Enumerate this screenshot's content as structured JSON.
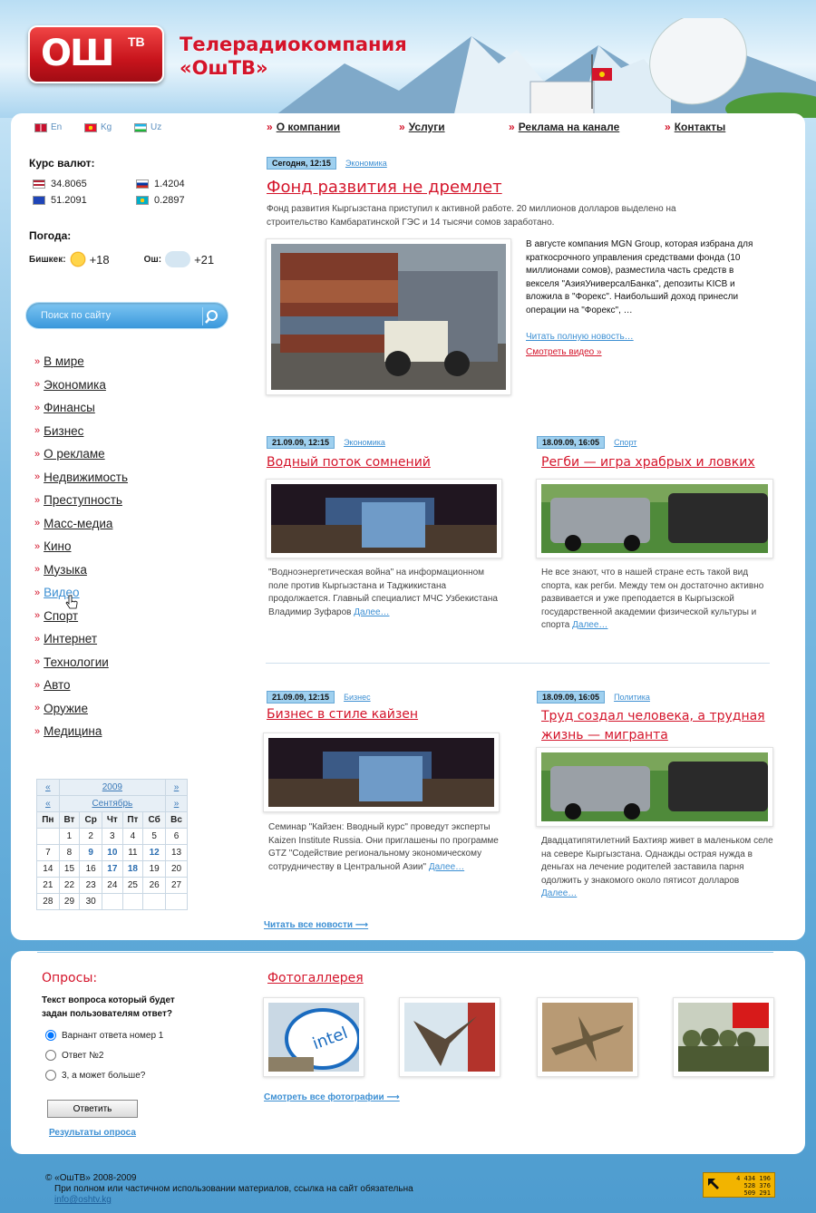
{
  "brand": {
    "logo": "ОШ",
    "logo_sup": "ТВ",
    "name_line1": "Телерадиокомпания",
    "name_line2": "«ОшТВ»"
  },
  "languages": [
    {
      "code": "En",
      "flag": "uk"
    },
    {
      "code": "Kg",
      "flag": "kg"
    },
    {
      "code": "Uz",
      "flag": "uz"
    }
  ],
  "nav": [
    "О компании",
    "Услуги",
    "Реклама на канале",
    "Контакты"
  ],
  "currency": {
    "title": "Курс валют:",
    "rates": [
      {
        "flag": "us",
        "value": "34.8065"
      },
      {
        "flag": "ru",
        "value": "1.4204"
      },
      {
        "flag": "eu",
        "value": "51.2091"
      },
      {
        "flag": "kz",
        "value": "0.2897"
      }
    ]
  },
  "weather": {
    "title": "Погода:",
    "city1": "Бишкек:",
    "temp1": "+18",
    "city2": "Ош:",
    "temp2": "+21"
  },
  "search": {
    "placeholder": "Поиск по сайту"
  },
  "categories": [
    "В мире",
    "Экономика",
    "Финансы",
    "Бизнес",
    "О рекламе",
    "Недвижимость",
    "Преступность",
    "Масс-медиа",
    "Кино",
    "Музыка",
    "Видео",
    "Спорт",
    "Интернет",
    "Технологии",
    "Авто",
    "Оружие",
    "Медицина"
  ],
  "active_category": "Видео",
  "calendar": {
    "year": "2009",
    "month": "Сентябрь",
    "prev": "«",
    "next": "»",
    "weekdays": [
      "Пн",
      "Вт",
      "Ср",
      "Чт",
      "Пт",
      "Сб",
      "Вс"
    ],
    "weeks": [
      [
        "",
        "1",
        "2",
        "3",
        "4",
        "5",
        "6"
      ],
      [
        "7",
        "8",
        "9",
        "10",
        "11",
        "12",
        "13"
      ],
      [
        "14",
        "15",
        "16",
        "17",
        "18",
        "19",
        "20"
      ],
      [
        "21",
        "22",
        "23",
        "24",
        "25",
        "26",
        "27"
      ],
      [
        "28",
        "29",
        "30",
        "",
        "",
        "",
        ""
      ]
    ],
    "linked": [
      "9",
      "10",
      "12",
      "17",
      "18"
    ]
  },
  "main": {
    "date": "Сегодня, 12:15",
    "category": "Экономика",
    "title": "Фонд развития не дремлет",
    "lead": "Фонд развития Кыргызстана приступил к активной работе. 20 миллионов долларов выделено на строительство Камбаратинской ГЭС и 14 тысячи сомов заработано.",
    "body": "В августе компания MGN Group, которая избрана для краткосрочного управления средствами фонда (10 миллионами сомов), разместила часть средств в векселя \"АзияУниверсалБанка\", депозиты KICB и вложила в \"Форекс\". Наибольший доход принесли операции на \"Форекс\", …",
    "read_full": "Читать полную новость…",
    "watch_video": "Смотреть видео »"
  },
  "news": [
    {
      "date": "21.09.09, 12:15",
      "category": "Экономика",
      "title": "Водный поток сомнений",
      "text": "\"Водноэнергетическая война\" на информационном поле против Кыргызстана и Таджикистана продолжается. Главный специалист МЧС Узбекистана Владимир Зуфаров",
      "more": "Далее…"
    },
    {
      "date": "18.09.09, 16:05",
      "category": "Спорт",
      "title": "Регби — игра храбрых и ловких",
      "text": "Не все знают, что в нашей стране есть такой вид спорта, как регби. Между тем он достаточно активно развивается и уже преподается в Кыргызской государственной академии физической культуры и спорта",
      "more": "Далее…"
    },
    {
      "date": "21.09.09, 12:15",
      "category": "Бизнес",
      "title": "Бизнес в стиле кайзен",
      "text": "Семинар \"Кайзен: Вводный курс\" проведут эксперты Kaizen Institute Russia. Они приглашены по программе GTZ \"Содействие региональному экономическому сотрудничеству в Центральной Азии\"",
      "more": "Далее…"
    },
    {
      "date": "18.09.09, 16:05",
      "category": "Политика",
      "title": "Труд создал человека, а трудная жизнь — мигранта",
      "text": "Двадцатипятилетний Бахтияр живет в маленьком селе на севере Кыргызстана. Однажды острая нужда в деньгах на лечение родителей заставила парня одолжить у знакомого около пятисот долларов",
      "more": "Далее…"
    }
  ],
  "read_all": "Читать все новости ⟶",
  "poll": {
    "title": "Опросы:",
    "question": "Текст вопроса который будет задан  пользователям ответ?",
    "options": [
      "Варнант ответа номер 1",
      "Ответ №2",
      "3, а может больше?"
    ],
    "submit": "Ответить",
    "results": "Результаты опроса"
  },
  "gallery": {
    "title": "Фотогаллерея",
    "view_all": "Смотреть все фотографии ⟶"
  },
  "footer": {
    "copyright": "© «ОшТВ» 2008-2009",
    "notice": "При полном или частичном использовании материалов, ссылка на сайт обязательна",
    "email": "info@oshtv.kg",
    "counter": [
      "4 434 196",
      "528 376",
      "509 291"
    ]
  }
}
